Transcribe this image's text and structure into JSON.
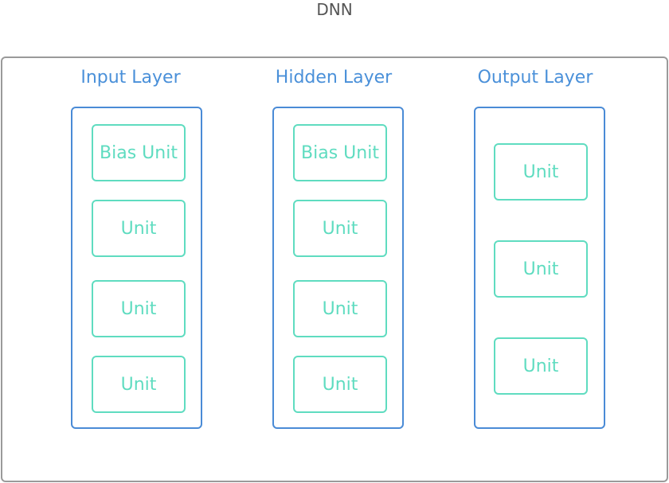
{
  "title": "DNN",
  "layers": [
    {
      "label": "Input Layer",
      "units": [
        "Bias Unit",
        "Unit",
        "Unit",
        "Unit"
      ]
    },
    {
      "label": "Hidden Layer",
      "units": [
        "Bias Unit",
        "Unit",
        "Unit",
        "Unit"
      ]
    },
    {
      "label": "Output Layer",
      "units": [
        "Unit",
        "Unit",
        "Unit"
      ]
    }
  ],
  "colors": {
    "title": "#555555",
    "outer_border": "#9a9a9a",
    "layer_label": "#4a90d9",
    "layer_border": "#4a8bd6",
    "unit": "#5fdcc0"
  }
}
